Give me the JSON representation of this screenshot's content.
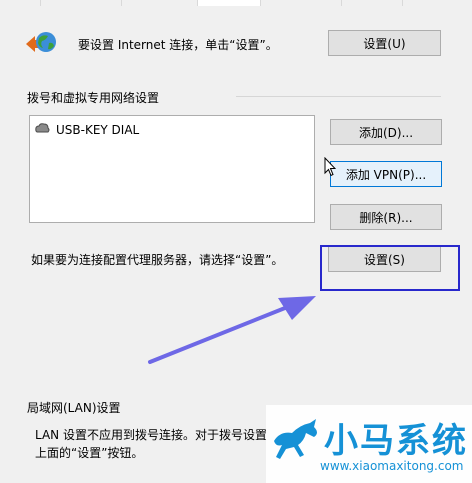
{
  "internet": {
    "text": "要设置 Internet 连接，单击“设置”。",
    "setup_button": "设置(U)"
  },
  "dialup": {
    "section_title": "拨号和虚拟专用网络设置",
    "connections": [
      "USB-KEY DIAL"
    ],
    "add_button": "添加(D)...",
    "add_vpn_button": "添加 VPN(P)...",
    "remove_button": "删除(R)...",
    "proxy_text": "如果要为连接配置代理服务器，请选择“设置”。",
    "settings_button": "设置(S)"
  },
  "lan": {
    "section_title": "局域网(LAN)设置",
    "line1": "LAN 设置不应用到拨号连接。对于拨号设置",
    "line2": "上面的“设置”按钮。"
  },
  "watermark": {
    "title": "小马系统",
    "url": "www.xiaomaxitong.com"
  },
  "colors": {
    "annotation_box": "#2828cc",
    "annotation_arrow": "#6e68e6",
    "watermark_blue": "#1591d6"
  }
}
